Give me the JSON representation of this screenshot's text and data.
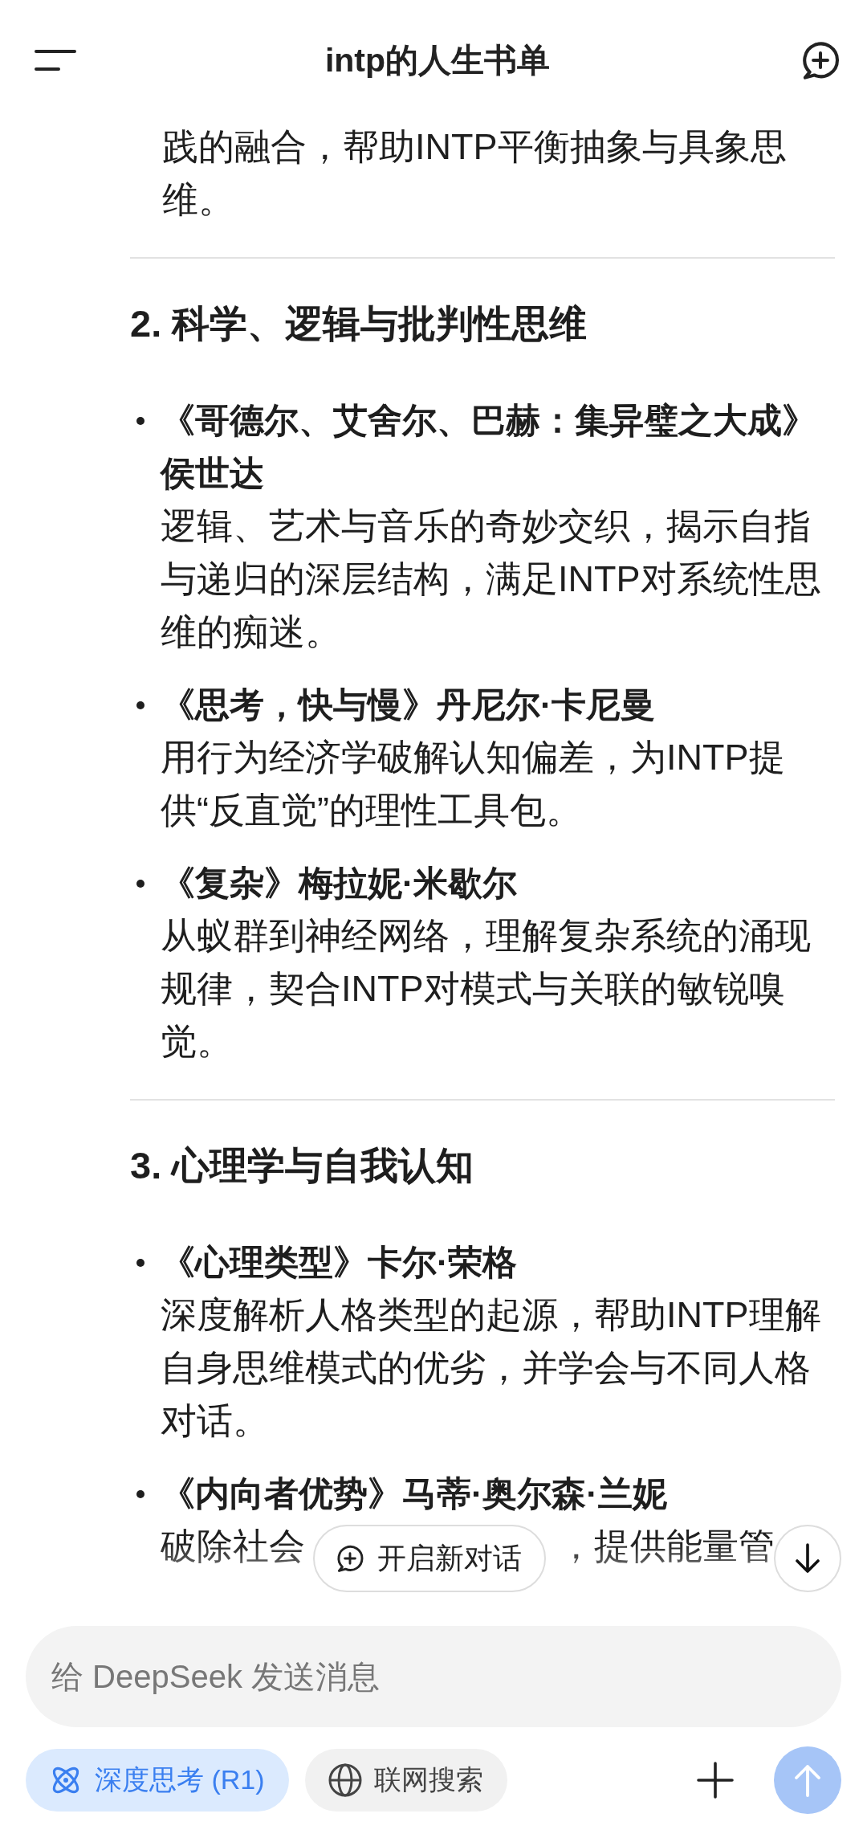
{
  "header": {
    "title": "intp的人生书单"
  },
  "preceding_text": "践的融合，帮助INTP平衡抽象与具象思维。",
  "sections": [
    {
      "heading": "2. 科学、逻辑与批判性思维",
      "books": [
        {
          "title": "《哥德尔、艾舍尔、巴赫：集异璧之大成》侯世达",
          "description": "逻辑、艺术与音乐的奇妙交织，揭示自指与递归的深层结构，满足INTP对系统性思维的痴迷。"
        },
        {
          "title": "《思考，快与慢》丹尼尔·卡尼曼",
          "description": "用行为经济学破解认知偏差，为INTP提供“反直觉”的理性工具包。"
        },
        {
          "title": "《复杂》梅拉妮·米歇尔",
          "description": "从蚁群到神经网络，理解复杂系统的涌现规律，契合INTP对模式与关联的敏锐嗅觉。"
        }
      ]
    },
    {
      "heading": "3. 心理学与自我认知",
      "books": [
        {
          "title": "《心理类型》卡尔·荣格",
          "description": "深度解析人格类型的起源，帮助INTP理解自身思维模式的优劣，并学会与不同人格对话。"
        },
        {
          "title": "《内向者优势》马蒂·奥尔森·兰妮",
          "description_parts": [
            "破除社会",
            "，提供能量管"
          ]
        }
      ]
    }
  ],
  "new_chat_chip": {
    "label": "开启新对话"
  },
  "composer": {
    "placeholder": "给 DeepSeek 发送消息"
  },
  "toggles": [
    {
      "kind": "deep-think",
      "label": "深度思考 (R1)",
      "on": true
    },
    {
      "kind": "web-search",
      "label": "联网搜索",
      "on": false
    }
  ],
  "send_button": {
    "disabled": true
  }
}
